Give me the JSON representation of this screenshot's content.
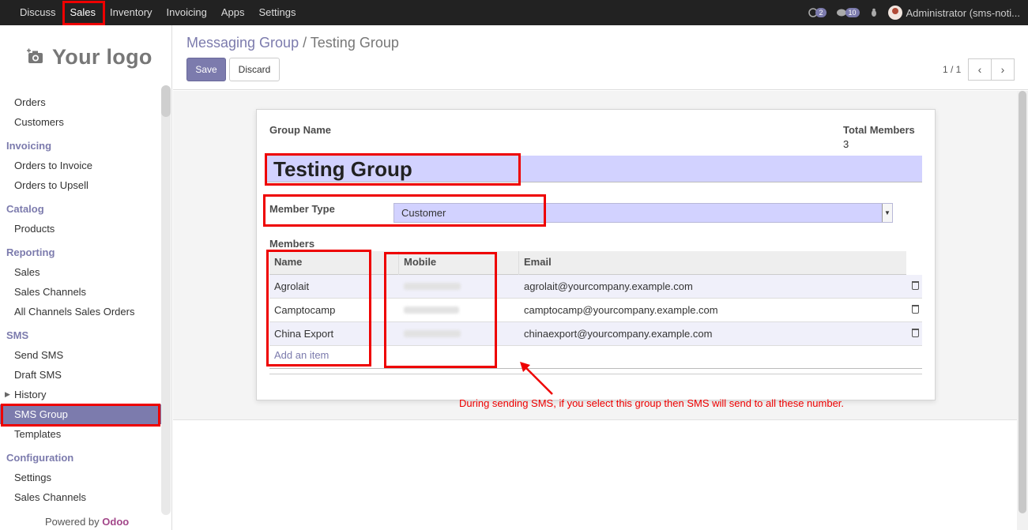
{
  "topnav": {
    "menu": [
      "Discuss",
      "Sales",
      "Inventory",
      "Invoicing",
      "Apps",
      "Settings"
    ],
    "active": "Sales",
    "chat_count": "2",
    "message_count": "10",
    "user": "Administrator (sms-noti..."
  },
  "sidebar": {
    "logo": "Your logo",
    "sections": [
      {
        "items": [
          "Orders",
          "Customers"
        ]
      },
      {
        "title": "Invoicing",
        "items": [
          "Orders to Invoice",
          "Orders to Upsell"
        ]
      },
      {
        "title": "Catalog",
        "items": [
          "Products"
        ]
      },
      {
        "title": "Reporting",
        "items": [
          "Sales",
          "Sales Channels",
          "All Channels Sales Orders"
        ]
      },
      {
        "title": "SMS",
        "items": [
          "Send SMS",
          "Draft SMS",
          "History",
          "SMS Group",
          "Templates"
        ]
      },
      {
        "title": "Configuration",
        "items": [
          "Settings",
          "Sales Channels"
        ]
      }
    ],
    "active_item": "SMS Group",
    "powered_by": "Powered by",
    "powered_brand": "Odoo"
  },
  "control_panel": {
    "breadcrumb_parent": "Messaging Group",
    "breadcrumb_sep": "/",
    "breadcrumb_current": "Testing Group",
    "save_label": "Save",
    "discard_label": "Discard",
    "pager": "1 / 1"
  },
  "form": {
    "group_name_label": "Group Name",
    "group_name_value": "Testing Group",
    "total_members_label": "Total Members",
    "total_members_value": "3",
    "member_type_label": "Member Type",
    "member_type_value": "Customer",
    "members_label": "Members",
    "columns": [
      "Name",
      "Mobile",
      "Email"
    ],
    "rows": [
      {
        "name": "Agrolait",
        "email": "agrolait@yourcompany.example.com"
      },
      {
        "name": "Camptocamp",
        "email": "camptocamp@yourcompany.example.com"
      },
      {
        "name": "China Export",
        "email": "chinaexport@yourcompany.example.com"
      }
    ],
    "add_item": "Add an item"
  },
  "annotation": {
    "note": "During sending SMS, if you select this group then SMS will send to all these number.",
    "color": "#ee0000"
  }
}
